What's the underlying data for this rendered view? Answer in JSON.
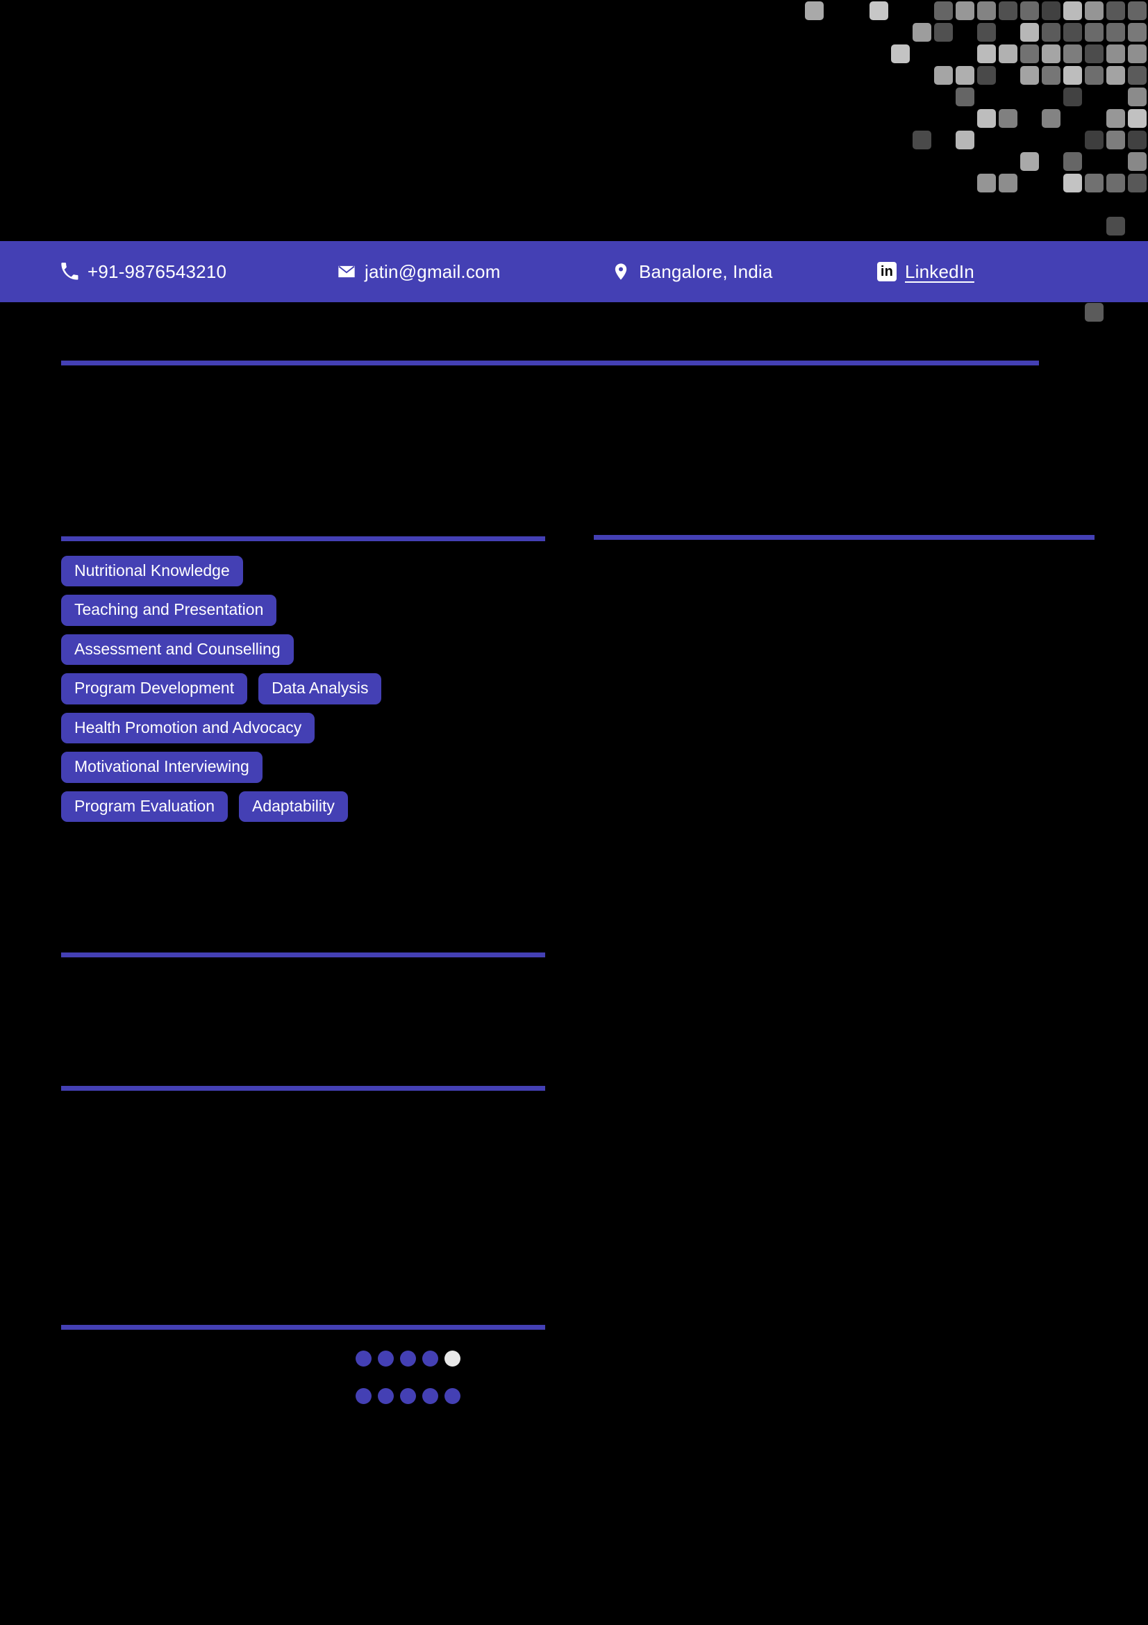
{
  "theme": {
    "background": "#000000",
    "accent": "#4440b4",
    "text": "#ffffff",
    "dot_empty": "#e8e8e8",
    "deco_square": "#c9c9c9"
  },
  "contact_bar": {
    "items": [
      {
        "icon": "phone-icon",
        "label": "+91-9876543210",
        "link": false
      },
      {
        "icon": "envelope-icon",
        "label": "jatin@gmail.com",
        "link": false
      },
      {
        "icon": "map-pin-icon",
        "label": "Bangalore, India",
        "link": false
      },
      {
        "icon": "linkedin-icon",
        "label": "LinkedIn",
        "link": true,
        "badge_text": "in"
      }
    ]
  },
  "skills": {
    "rows": [
      [
        "Nutritional Knowledge"
      ],
      [
        "Teaching and Presentation"
      ],
      [
        "Assessment and Counselling"
      ],
      [
        "Program Development",
        "Data Analysis"
      ],
      [
        "Health Promotion and Advocacy"
      ],
      [
        "Motivational Interviewing"
      ],
      [
        "Program Evaluation",
        "Adaptability"
      ]
    ]
  },
  "ratings": [
    {
      "filled": 4,
      "total": 5
    },
    {
      "filled": 5,
      "total": 5
    }
  ]
}
